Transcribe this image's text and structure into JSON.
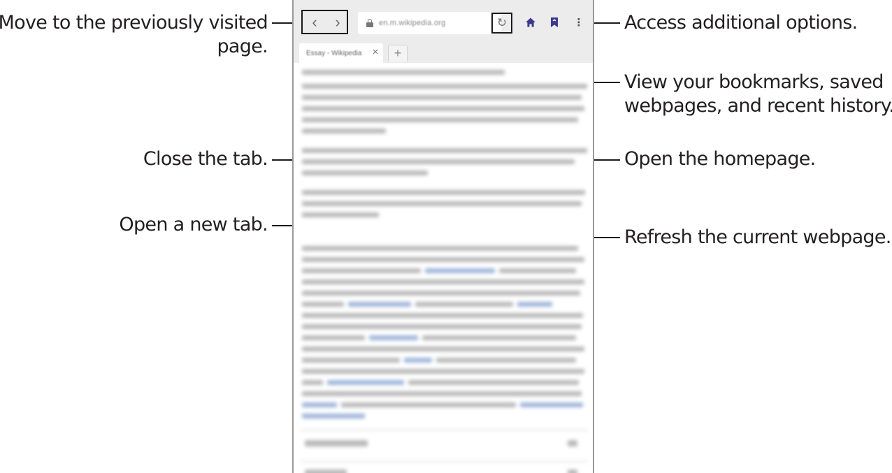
{
  "browser": {
    "url": "en.m.wikipedia.org",
    "tab_title": "Essay - Wikipedia",
    "back_icon": "‹",
    "forward_icon": "›",
    "close_icon": "×",
    "new_tab_icon": "+",
    "refresh_icon": "↻",
    "more_icon": "⋮",
    "accent_color": "#3b3a8c"
  },
  "callouts": {
    "back": "Move to the previously visited page.",
    "back_line1": "Move to the previously visited",
    "back_line2": "page.",
    "close_tab": "Close the tab.",
    "new_tab": "Open a new tab.",
    "more": "Access additional options.",
    "bookmarks_line1": "View your bookmarks, saved",
    "bookmarks_line2": "webpages, and recent history.",
    "home": "Open the homepage.",
    "refresh": "Refresh the current webpage."
  }
}
